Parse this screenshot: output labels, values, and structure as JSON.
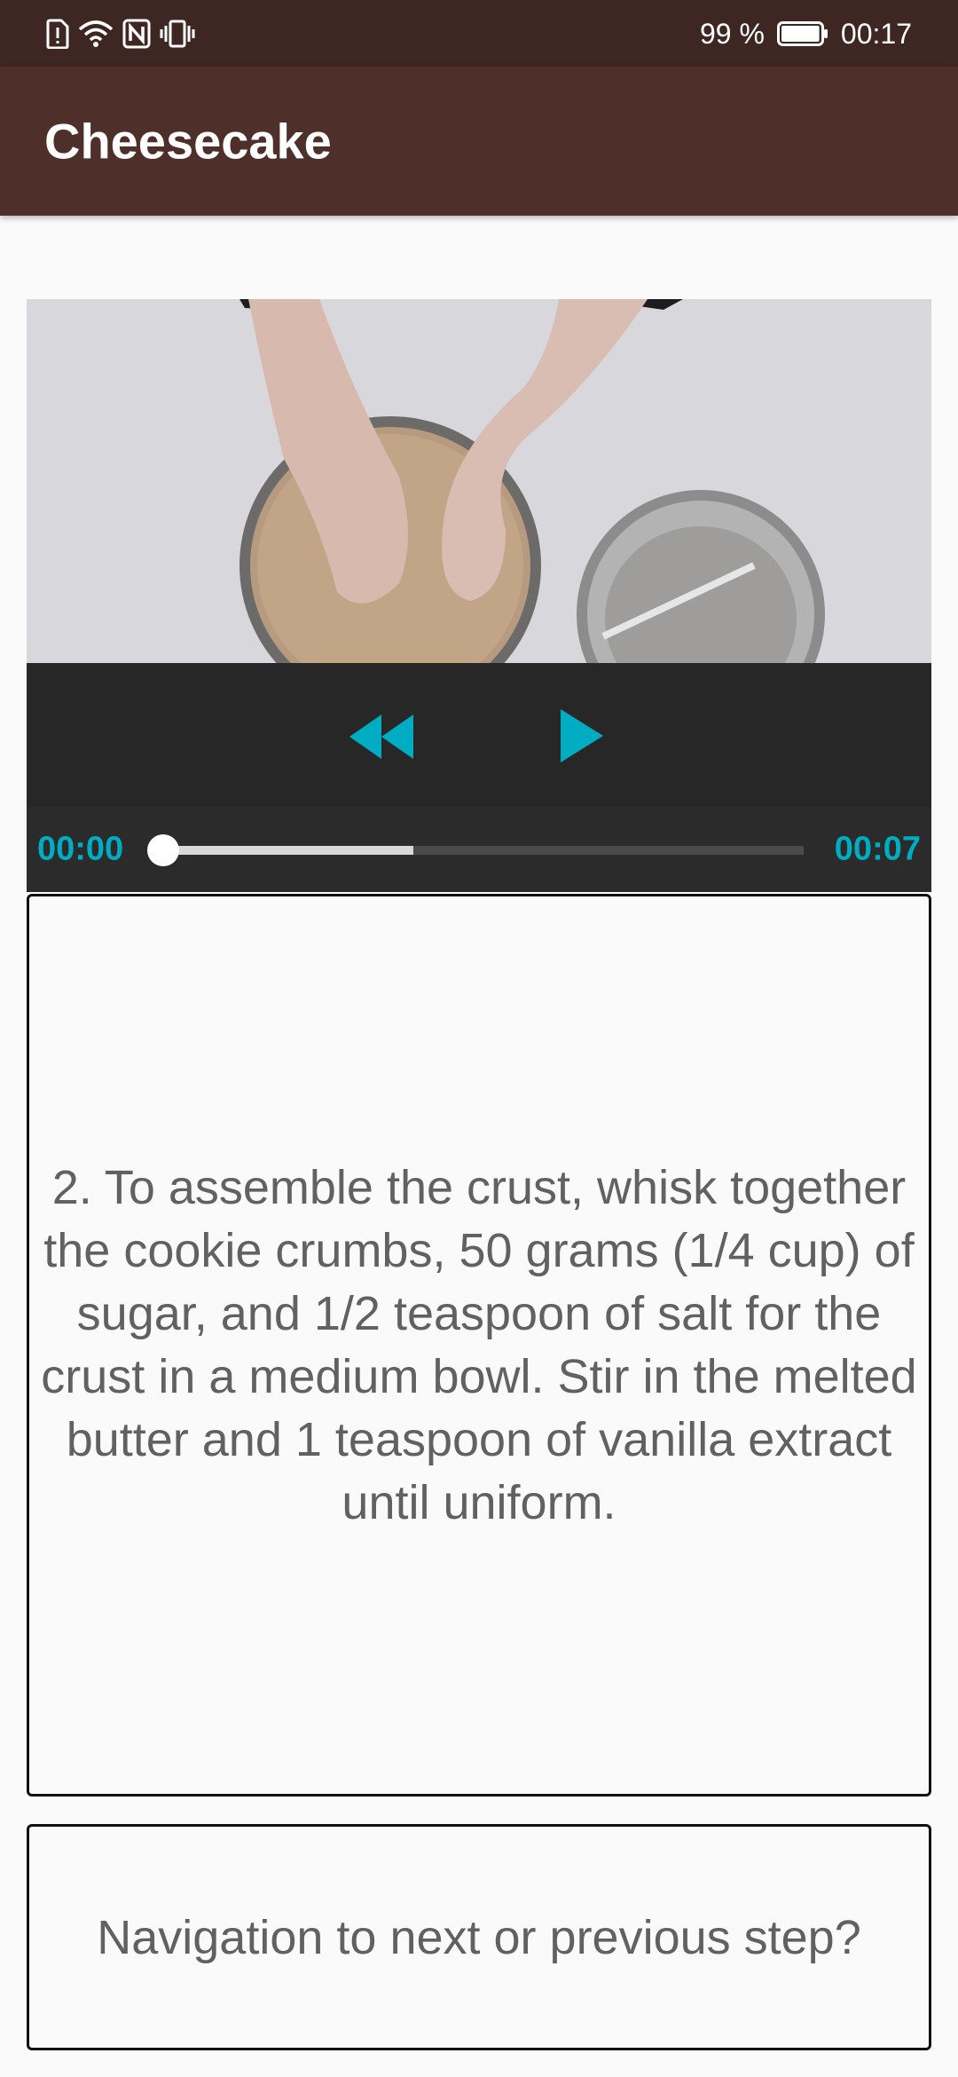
{
  "status_bar": {
    "battery_percent": "99 %",
    "time": "00:17",
    "icons": [
      "sim-alert-icon",
      "wifi-icon",
      "nfc-icon",
      "vibrate-icon",
      "battery-icon"
    ],
    "battery_level": 0.99
  },
  "app_bar": {
    "title": "Cheesecake"
  },
  "video_player": {
    "current_time": "00:00",
    "total_time": "00:07",
    "position_fraction": 0.0,
    "buffered_fraction": 0.39,
    "controls": {
      "rewind_icon": "rewind-icon",
      "play_icon": "play-icon"
    },
    "accent_color": "#00acc1"
  },
  "step": {
    "description": "2. To assemble the crust, whisk together the cookie crumbs, 50 grams (1/4 cup) of sugar, and 1/2 teaspoon of salt for the crust in a medium bowl. Stir in the melted butter and 1 teaspoon of vanilla extract until uniform."
  },
  "navigation": {
    "prompt": "Navigation to next or previous step?"
  },
  "colors": {
    "status_bar": "#3e2723",
    "app_bar": "#4e2f2a",
    "accent": "#00acc1"
  }
}
